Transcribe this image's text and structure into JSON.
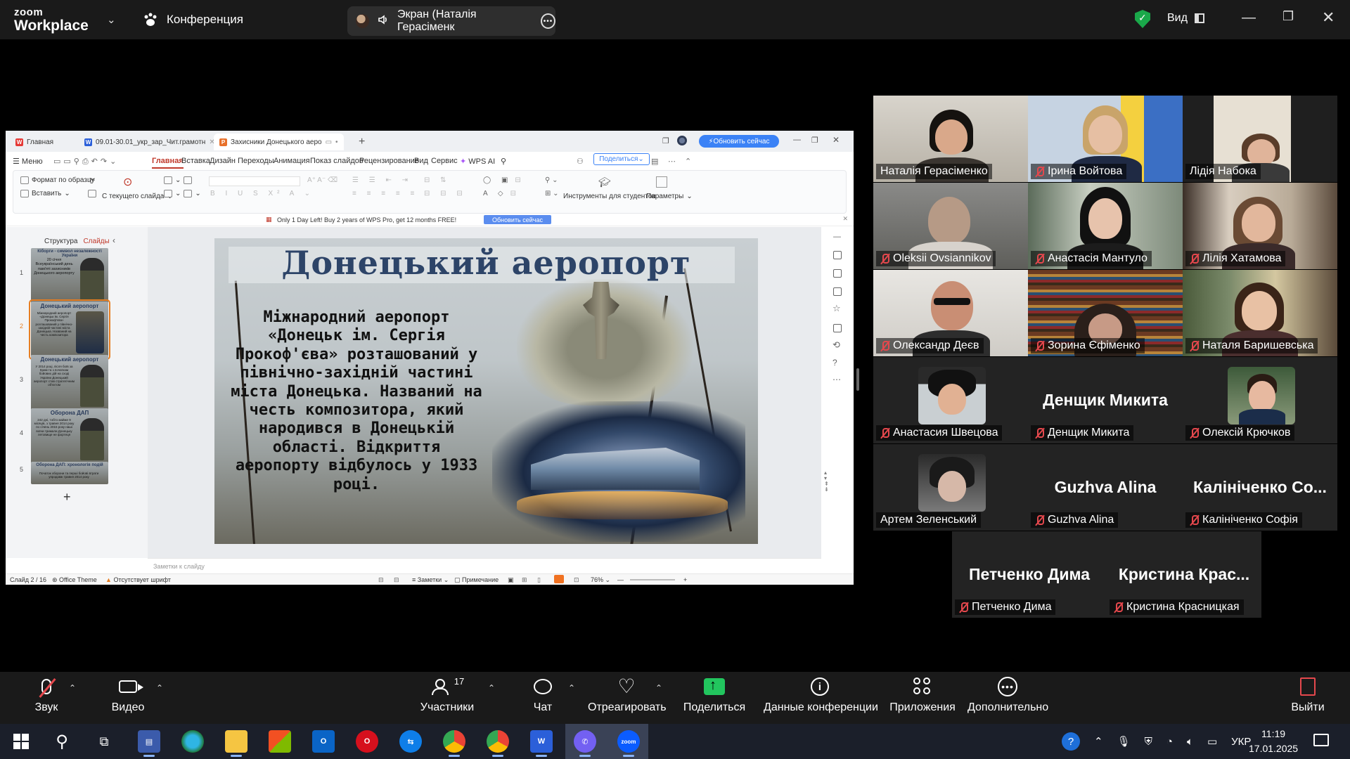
{
  "zoom": {
    "logo_line1": "zoom",
    "logo_line2": "Workplace",
    "conference_label": "Конференция",
    "screen_share_label": "Экран (Наталія Герасіменк",
    "view_label": "Вид",
    "colors": {
      "bg": "#000000",
      "bar": "#1a1a1a",
      "active_speaker": "#22c55e",
      "muted": "#e5484d",
      "share": "#22c55e"
    }
  },
  "wps": {
    "tabs": [
      {
        "label": "Главная",
        "icon": "wps-icon"
      },
      {
        "label": "09.01-30.01_укр_зар_Чит.грамотн",
        "icon": "word-icon"
      },
      {
        "label": "Захисники Донецького аеро",
        "icon": "presentation-icon"
      }
    ],
    "update_button": "Обновить сейчас",
    "menu": [
      "Меню",
      "Главная",
      "Вставка",
      "Дизайн",
      "Переходы",
      "Анимация",
      "Показ слайдов",
      "Рецензирование",
      "Вид",
      "Сервис",
      "WPS AI"
    ],
    "share_button": "Поделиться",
    "ribbon": {
      "format_painter": "Формат по образцу",
      "paste": "Вставить",
      "from_current": "С текущего слайда",
      "student_tools": "Инструменты для студентов",
      "params": "Параметры"
    },
    "promo_text": "Only 1 Day Left! Buy 2 years of WPS Pro, get 12 months FREE!",
    "promo_button": "Обновить сейчас",
    "panel_tabs": [
      "Структура",
      "Слайды"
    ],
    "thumbnails": [
      {
        "num": "1",
        "title": "Кіборги - символ незалежності України",
        "body": "20 січня Всеукраїнський день пам'яті захисників Донецького аеропорту"
      },
      {
        "num": "2",
        "title": "Донецький аеропорт",
        "body": "Міжнародний аеропорт «Донецьк ім. Сергія Прокоф'єва» розташований у північно-західній частині міста Донецька. Названий на честь композитора"
      },
      {
        "num": "3",
        "title": "Донецький аеропорт",
        "body": "У 2014 році, після боїв за Крим та з початком бойових дій на сході України Донецький аеропорт став стратегічним об'єктом"
      },
      {
        "num": "4",
        "title": "Оборона ДАП",
        "body": "242 дні, тобто майже 9 місяців, з травня 2014 року по січень 2015 року наші воїни тримали Донецьку летовище не фортеця"
      },
      {
        "num": "5",
        "title": "Оборона ДАП: хронологія подій",
        "body": "Початок оборони та перші бойові втрати упродовж травня 2014 року"
      }
    ],
    "slide": {
      "title": "Донецький аеропорт",
      "body": "Міжнародний аеропорт «Донецьк ім. Сергія Прокоф'єва» розташований у північно-західній частині міста Донецька. Названий на честь композитора, який народився в Донецькій області. Відкриття аеропорту відбулось у 1933 році."
    },
    "notes_placeholder": "Заметки к слайду",
    "status": {
      "slide_counter": "Слайд 2 / 16",
      "theme": "Office Theme",
      "missing_font": "Отсутствует шрифт",
      "notes": "Заметки",
      "comment": "Примечание",
      "zoom": "76%"
    }
  },
  "participants": [
    {
      "name": "Наталія Герасіменко",
      "muted": false,
      "video": true,
      "active": true
    },
    {
      "name": "Ірина Войтова",
      "muted": true,
      "video": true
    },
    {
      "name": "Лідія Набока",
      "muted": false,
      "video": true
    },
    {
      "name": "Oleksii Ovsiannikov",
      "muted": true,
      "video": true
    },
    {
      "name": "Анастасія Мантуло",
      "muted": true,
      "video": true
    },
    {
      "name": "Лілія Хатамова",
      "muted": true,
      "video": true
    },
    {
      "name": "Олександр Деєв",
      "muted": true,
      "video": true
    },
    {
      "name": "Зорина  Єфіменко",
      "muted": true,
      "video": true
    },
    {
      "name": "Наталя Баришевська",
      "muted": true,
      "video": true
    },
    {
      "name": "Анастасия Швецова",
      "muted": true,
      "video": false
    },
    {
      "name": "Денщик Микита",
      "display": "Денщик Микита",
      "muted": true,
      "video": false
    },
    {
      "name": "Олексій Крючков",
      "muted": true,
      "video": false
    },
    {
      "name": "Артем Зеленський",
      "muted": false,
      "video": false
    },
    {
      "name": "Guzhva Alina",
      "display": "Guzhva Alina",
      "muted": true,
      "video": false
    },
    {
      "name": "Калініченко Софія",
      "display": "Калініченко Со...",
      "muted": true,
      "video": false
    },
    {
      "name": "Петченко Дима",
      "display": "Петченко Дима",
      "muted": true,
      "video": false
    },
    {
      "name": "Кристина Красницкая",
      "display": "Кристина Крас...",
      "muted": true,
      "video": false
    }
  ],
  "toolbar": {
    "audio": "Звук",
    "video": "Видео",
    "participants": "Участники",
    "participants_count": "17",
    "chat": "Чат",
    "react": "Отреагировать",
    "share": "Поделиться",
    "info": "Данные конференции",
    "apps": "Приложения",
    "more": "Дополнительно",
    "leave": "Выйти"
  },
  "taskbar": {
    "language": "УКР",
    "time": "11:19",
    "date": "17.01.2025"
  }
}
